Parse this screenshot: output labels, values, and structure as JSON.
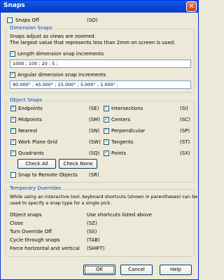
{
  "window": {
    "title": "Snaps",
    "close_glyph": "✕"
  },
  "snaps_off": {
    "label": "Snaps Off",
    "shortcut": "(SO)",
    "checked": false
  },
  "dimension": {
    "title": "Dimension Snaps",
    "desc1": "Snaps adjust as views are zoomed.",
    "desc2": "The largest value that represents less than 2mm on screen is used.",
    "length_label": "Length dimension snap increments",
    "length_value": "1000 ; 100 ; 20 ; 5 ;",
    "angular_label": "Angular dimension snap increments",
    "angular_value": "90.000° ; 45.000° ; 15.000° ; 5.000° ; 1.000° ;"
  },
  "object_snaps": {
    "title": "Object Snaps",
    "left": [
      {
        "label": "Endpoints",
        "shortcut": "(SE)"
      },
      {
        "label": "Midpoints",
        "shortcut": "(SM)"
      },
      {
        "label": "Nearest",
        "shortcut": "(SN)"
      },
      {
        "label": "Work Plane Grid",
        "shortcut": "(SW)"
      },
      {
        "label": "Quadrants",
        "shortcut": "(SQ)"
      }
    ],
    "right": [
      {
        "label": "Intersections",
        "shortcut": "(SI)"
      },
      {
        "label": "Centers",
        "shortcut": "(SC)"
      },
      {
        "label": "Perpendicular",
        "shortcut": "(SP)"
      },
      {
        "label": "Tangents",
        "shortcut": "(ST)"
      },
      {
        "label": "Points",
        "shortcut": "(SX)"
      }
    ],
    "check_all": "Check All",
    "check_none": "Check None",
    "remote_label": "Snap to Remote Objects",
    "remote_shortcut": "(SR)"
  },
  "overrides": {
    "title": "Temporary Overrides",
    "desc1": "While using an interactive tool, keyboard shortcuts (shown in parentheses) can be",
    "desc2": "used to specify a snap type for a single pick.",
    "rows": [
      {
        "label": "Object snaps",
        "value": "Use shortcuts listed above"
      },
      {
        "label": "Close",
        "value": "(SZ)"
      },
      {
        "label": "Turn Override Off",
        "value": "(SS)"
      },
      {
        "label": "Cycle through snaps",
        "value": "(TAB)"
      },
      {
        "label": "Force horizontal and vertical",
        "value": "(SHIFT)"
      }
    ]
  },
  "footer": {
    "ok": "OK",
    "cancel": "Cancel",
    "help": "Help"
  }
}
